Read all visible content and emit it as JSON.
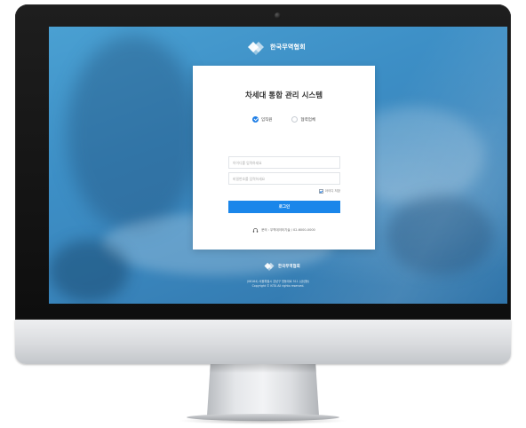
{
  "brand": {
    "name": "한국무역협회",
    "logo_icon": "kita-logo-icon"
  },
  "login": {
    "title": "차세대 통합 관리 시스템",
    "radio_options": [
      {
        "label": "임직원",
        "checked": true
      },
      {
        "label": "협력업체",
        "checked": false
      }
    ],
    "id_placeholder": "아이디를 입력하세요",
    "password_placeholder": "비밀번호를 입력하세요",
    "save_id_label": "아이디 저장",
    "save_id_checked": true,
    "login_button": "로그인",
    "support_text": "문의 : 무역데이터기술 / 02-6000-0000",
    "support_icon": "headset-icon"
  },
  "footer": {
    "address": "(06164) 서울특별시 강남구 영동대로 511 (삼성동)",
    "copyright": "Copyright © KITA All rights reserved."
  },
  "colors": {
    "primary": "#1a86ea",
    "screen_bg": "#3d8fc6",
    "card_bg": "#ffffff"
  }
}
